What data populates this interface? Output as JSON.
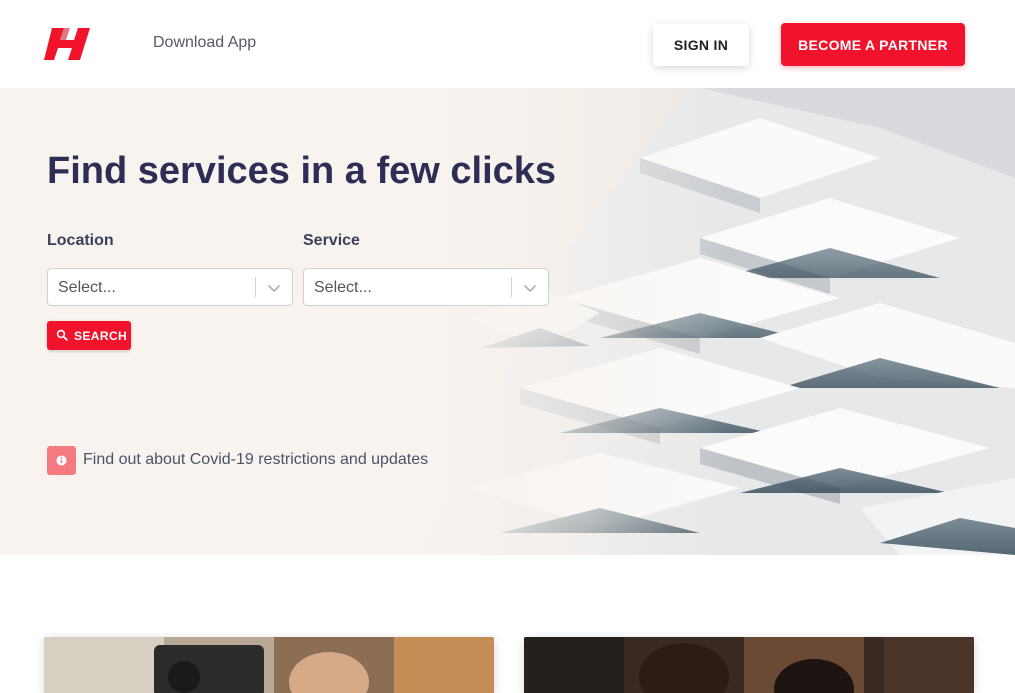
{
  "header": {
    "logo_alt": "H",
    "download_link": "Download App",
    "signin_label": "SIGN IN",
    "partner_label": "BECOME A PARTNER"
  },
  "hero": {
    "title": "Find services in a few clicks",
    "location": {
      "label": "Location",
      "placeholder": "Select..."
    },
    "service": {
      "label": "Service",
      "placeholder": "Select..."
    },
    "search_label": "SEARCH",
    "covid_text": "Find out about Covid-19 restrictions and updates"
  },
  "colors": {
    "brand_red": "#f0132b",
    "title_navy": "#2e2d56",
    "info_pink": "#f47a80"
  },
  "icons": {
    "logo": "h-logo-icon",
    "chevron": "chevron-down-icon",
    "search": "search-icon",
    "info": "info-icon"
  }
}
